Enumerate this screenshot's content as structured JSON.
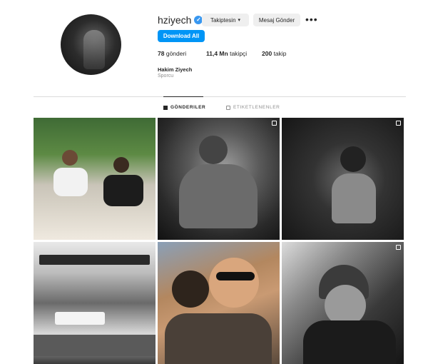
{
  "profile": {
    "username": "hziyech",
    "following_button": "Takiptesin",
    "message_button": "Mesaj Gönder",
    "more": "•••",
    "download_button": "Download All",
    "posts_count": "78",
    "posts_label": "gönderi",
    "followers_count": "11,4 Mn",
    "followers_label": "takipçi",
    "following_count": "200",
    "following_label": "takip",
    "full_name": "Hakim Ziyech",
    "category": "Sporcu"
  },
  "tabs": {
    "posts": "GÖNDERILER",
    "tagged": "ETIKETLENENLER"
  },
  "colors": {
    "accent": "#0095f6",
    "verified": "#3897f0",
    "secondary_text": "#8e8e8e"
  },
  "icons": {
    "verified": "verified-badge-icon",
    "chevron": "chevron-down-icon",
    "posts_tab": "grid-icon",
    "tagged_tab": "tagged-icon",
    "multi": "multiple-photos-icon"
  }
}
